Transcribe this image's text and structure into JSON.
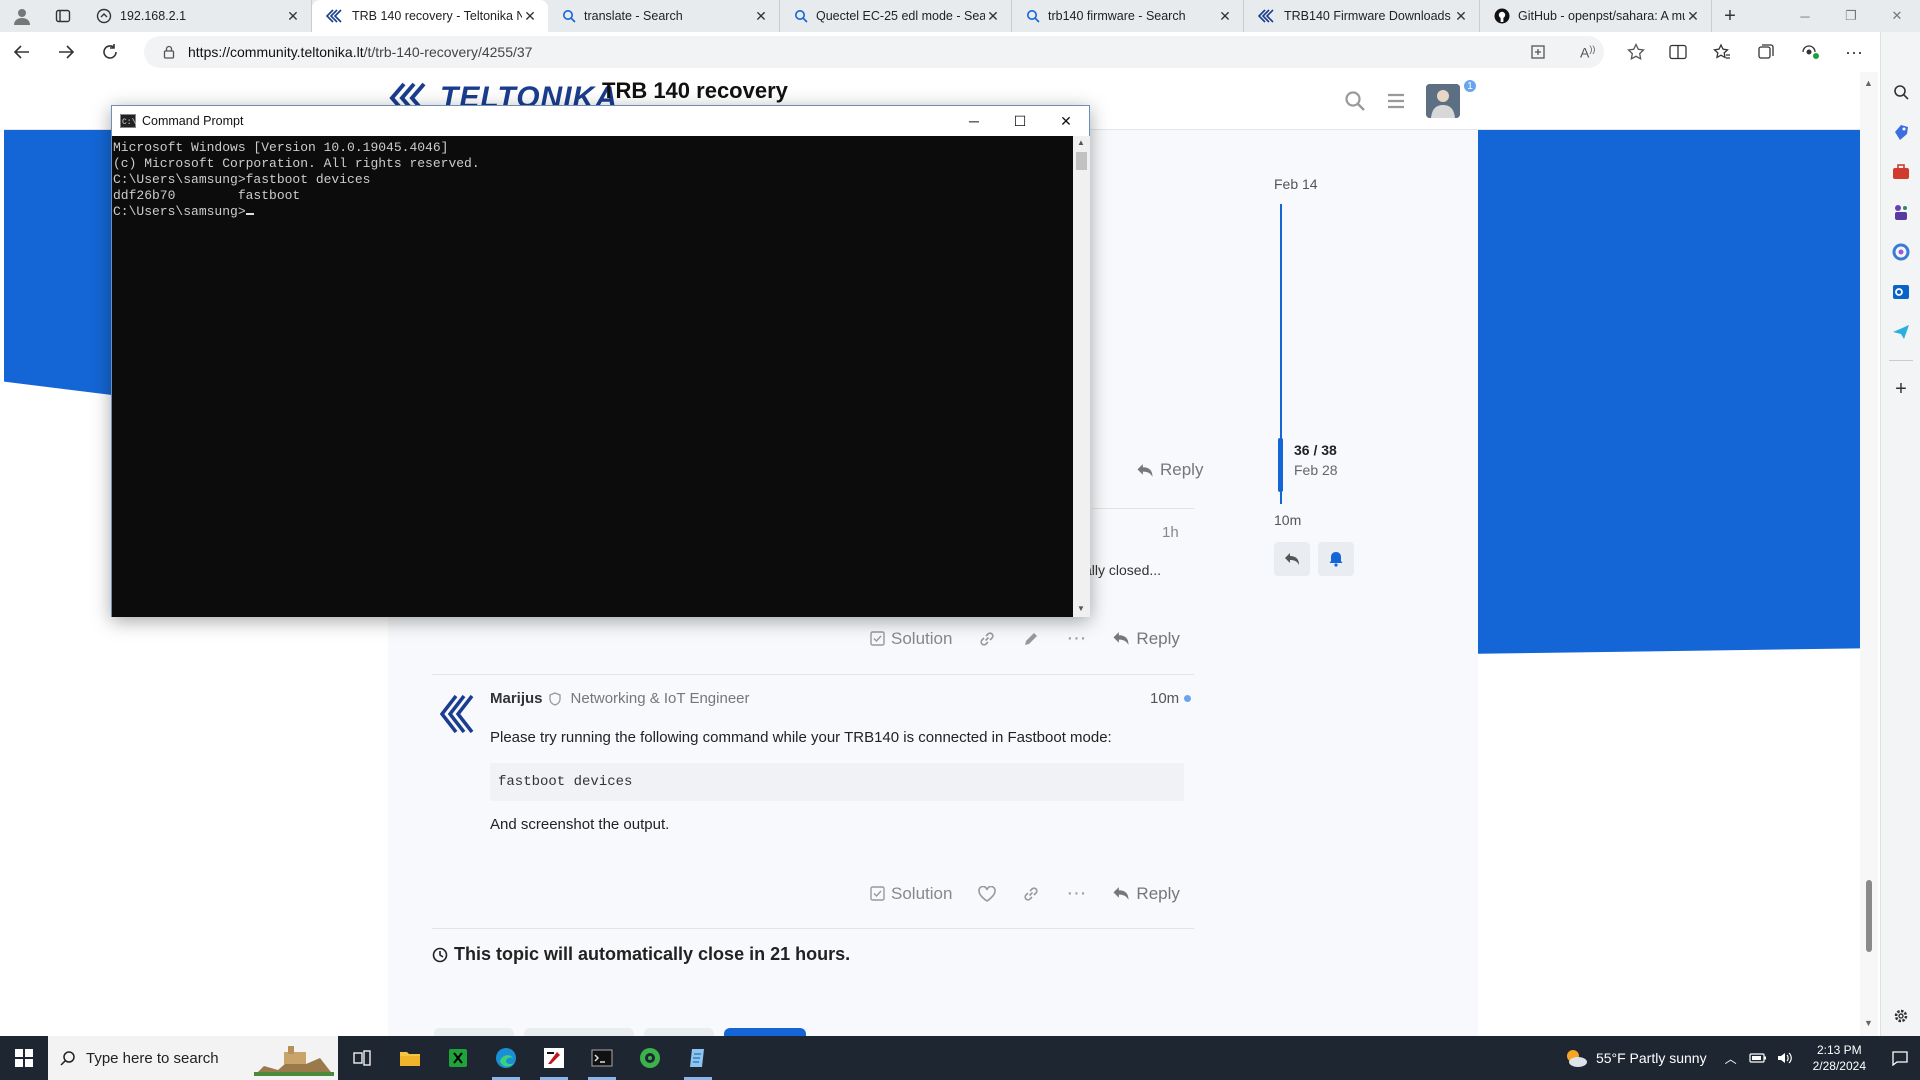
{
  "browser": {
    "tabs": [
      {
        "title": "192.168.2.1",
        "icon": "page-icon",
        "active": false
      },
      {
        "title": "TRB 140 recovery - Teltonika Ne",
        "icon": "teltonika-icon",
        "active": true
      },
      {
        "title": "translate - Search",
        "icon": "search-icon",
        "active": false
      },
      {
        "title": "Quectel EC-25 edl mode - Sear",
        "icon": "search-icon",
        "active": false
      },
      {
        "title": "trb140 firmware - Search",
        "icon": "search-icon",
        "active": false
      },
      {
        "title": "TRB140 Firmware Downloads -",
        "icon": "teltonika-icon",
        "active": false
      },
      {
        "title": "GitHub - openpst/sahara: A mu",
        "icon": "github-icon",
        "active": false
      }
    ],
    "url_host": "https://community.teltonika.lt",
    "url_path": "/t/trb-140-recovery/4255/37"
  },
  "page": {
    "topic_title": "TRB 140 recovery",
    "logo_text": "TELTONIKA",
    "notification_count": "1",
    "timeline": {
      "top_date": "Feb 14",
      "position": "36 / 38",
      "position_date": "Feb 28",
      "last_activity": "10m"
    },
    "post_previous": {
      "reply_label": "Reply",
      "time": "1h",
      "snippet": "ally closed...",
      "solution_label": "Solution",
      "reply_label2": "Reply"
    },
    "post_marijus": {
      "author": "Marijus",
      "author_title": "Networking & IoT Engineer",
      "time": "10m",
      "text1": "Please try running the following command while your TRB140 is connected in Fastboot mode:",
      "code": "fastboot devices",
      "text2": "And screenshot the output.",
      "solution_label": "Solution",
      "reply_label": "Reply"
    },
    "auto_close_notice": "This topic will automatically close in 21 hours."
  },
  "cmd": {
    "title": "Command Prompt",
    "lines": [
      "Microsoft Windows [Version 10.0.19045.4046]",
      "(c) Microsoft Corporation. All rights reserved.",
      "",
      "C:\\Users\\samsung>fastboot devices",
      "ddf26b70        fastboot",
      ""
    ],
    "prompt": "C:\\Users\\samsung>"
  },
  "taskbar": {
    "search_placeholder": "Type here to search",
    "weather": "55°F  Partly sunny",
    "time": "2:13 PM",
    "date": "2/28/2024"
  },
  "colors": {
    "brand_blue": "#1466d6",
    "taskbar": "#1e2632",
    "console_bg": "#0c0c0c"
  }
}
